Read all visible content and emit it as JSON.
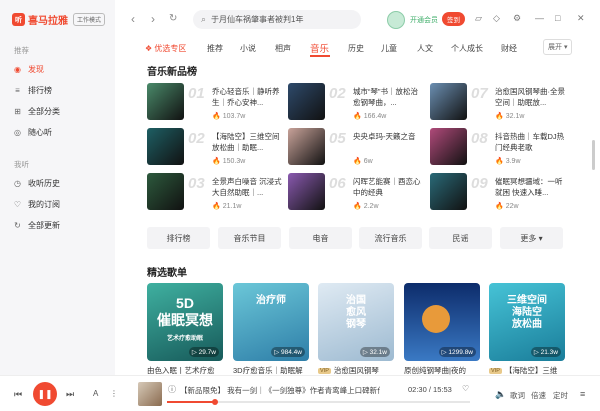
{
  "app": {
    "name": "喜马拉雅",
    "logo_char": "听",
    "mode_badge": "工作模式"
  },
  "sidebar": {
    "section1": "推荐",
    "items1": [
      {
        "label": "发现",
        "icon": "discover-icon",
        "active": true
      },
      {
        "label": "排行榜",
        "icon": "chart-icon"
      },
      {
        "label": "全部分类",
        "icon": "grid-icon"
      },
      {
        "label": "随心听",
        "icon": "radio-icon"
      }
    ],
    "section2": "我听",
    "items2": [
      {
        "label": "收听历史",
        "icon": "history-icon"
      },
      {
        "label": "我的订阅",
        "icon": "subscribe-icon"
      },
      {
        "label": "全部更新",
        "icon": "update-icon"
      }
    ]
  },
  "topbar": {
    "search_text": "于月仙车祸肇事者被判1年",
    "vip_label": "开通会员",
    "promo_badge": "签到"
  },
  "tabs": {
    "items": [
      "优选专区",
      "推荐",
      "小说",
      "相声",
      "音乐",
      "历史",
      "儿童",
      "人文",
      "个人成长",
      "财经"
    ],
    "active": "音乐",
    "expand_label": "展开"
  },
  "new_chart": {
    "title": "音乐新品榜",
    "items": [
      {
        "rank": "01",
        "title": "乔心轻音乐｜静听养生｜乔心安神...",
        "plays": "103.7w",
        "cover_color": "#4a8a6a"
      },
      {
        "rank": "02",
        "title": "城市“琴”书｜放松治愈钢琴曲，...",
        "plays": "166.4w",
        "cover_color": "#2e4a6b"
      },
      {
        "rank": "07",
        "title": "治愈国风钢琴曲·全景空间｜助眠放...",
        "plays": "32.1w",
        "cover_color": "#6b8fb2"
      },
      {
        "rank": "02",
        "title": "【海陆空】三维空间放松曲｜助眠...",
        "plays": "150.3w",
        "cover_color": "#1e5f64"
      },
      {
        "rank": "05",
        "title": "央央卓玛-天籁之音",
        "plays": "6w",
        "cover_color": "#c9a39a"
      },
      {
        "rank": "08",
        "title": "抖音热曲｜车载DJ热门经典老歌",
        "plays": "3.9w",
        "cover_color": "#b04a7a"
      },
      {
        "rank": "03",
        "title": "全景声白噪音 沉浸式大自然助眠｜...",
        "plays": "21.1w",
        "cover_color": "#2d5a3d"
      },
      {
        "rank": "06",
        "title": "闪晖艺能赛｜酉恋心中的经典",
        "plays": "2.2w",
        "cover_color": "#8a5ab0"
      },
      {
        "rank": "09",
        "title": "催眠冥想疆域：一听就困 快速入睡...",
        "plays": "22w",
        "cover_color": "#2a6a78"
      }
    ]
  },
  "categories": [
    "排行榜",
    "音乐节目",
    "电音",
    "流行音乐",
    "民谣",
    "更多"
  ],
  "playlists": {
    "title": "精选歌单",
    "items": [
      {
        "title": "由色入眠丨艺术疗愈",
        "count": "29.7w",
        "vip": false,
        "cover_text": "5D\n催眠冥想",
        "cover_sub": "艺术疗愈助眠",
        "bg": "linear-gradient(160deg,#3fb0a0,#175a5a)"
      },
      {
        "title": "3D疗愈音乐｜助眠解",
        "count": "984.4w",
        "vip": false,
        "cover_text": "治疗师",
        "cover_sub": "",
        "bg": "linear-gradient(160deg,#6bc7d8,#2e7ea8)"
      },
      {
        "title": "治愈国风钢琴",
        "count": "32.1w",
        "vip": true,
        "cover_text": "治国\n愈风\n钢琴",
        "cover_sub": "",
        "bg": "linear-gradient(160deg,#dfeaf3,#9dbad1)"
      },
      {
        "title": "原创纯钢琴曲|夜的",
        "count": "1299.8w",
        "vip": false,
        "cover_text": "",
        "cover_sub": "",
        "bg": "linear-gradient(180deg,#0d2c6b,#3a79c4)"
      },
      {
        "title": "【海陆空】三维",
        "count": "21.3w",
        "vip": true,
        "cover_text": "三维空间\n海陆空\n放松曲",
        "cover_sub": "",
        "bg": "linear-gradient(160deg,#46c3d6,#1a7d9a)"
      }
    ]
  },
  "player": {
    "track_text": "【新品限免】 我有一剑｜《一剑独尊》作者青鸾峰上口碑新作｜有声",
    "time_current": "02:30",
    "time_total": "15:53",
    "progress_fraction": 0.157,
    "labels": {
      "lyrics": "歌词",
      "speed": "倍速",
      "timer": "定时"
    }
  },
  "colors": {
    "accent": "#f04a31",
    "vip_green": "#3fae6a"
  }
}
